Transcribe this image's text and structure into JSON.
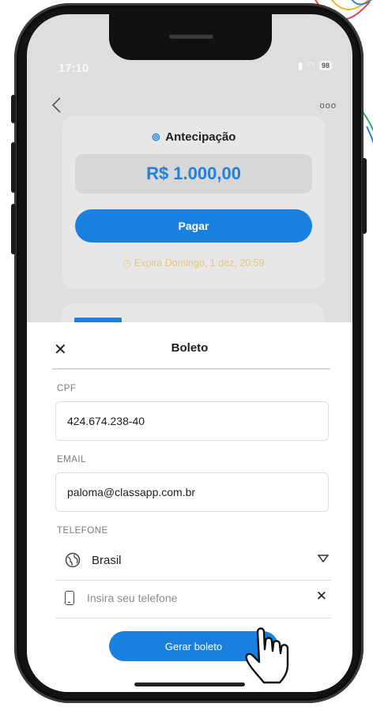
{
  "status_bar": {
    "time": "17:10",
    "battery": "98"
  },
  "nav": {
    "back_icon": "chevron-left-icon",
    "more_label": "ooo"
  },
  "anticipation_card": {
    "icon": "money-icon",
    "title": "Antecipação",
    "amount": "R$ 1.000,00",
    "pay_label": "Pagar",
    "clock_icon": "clock-icon",
    "expires": "Expira Domingo, 1 dez, 20:59"
  },
  "sheet": {
    "title": "Boleto",
    "close_label": "✕",
    "cpf_label": "CPF",
    "cpf_value": "424.674.238-40",
    "email_label": "EMAIL",
    "email_value": "paloma@classapp.com.br",
    "phone_label": "TELEFONE",
    "country": "Brasil",
    "phone_placeholder": "Insira seu telefone",
    "clear_label": "✕",
    "generate_label": "Gerar boleto"
  },
  "colors": {
    "accent": "#1a80e0",
    "warning": "#e3c77a"
  }
}
